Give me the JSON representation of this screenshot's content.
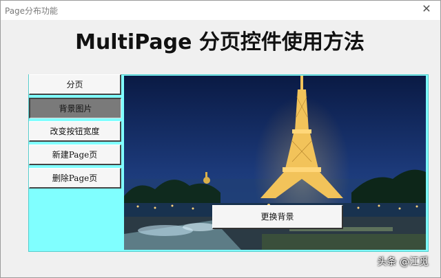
{
  "window": {
    "title": "Page分布功能",
    "close_glyph": "✕"
  },
  "heading": "MultiPage 分页控件使用方法",
  "tabs": [
    {
      "label": "分页",
      "active": false
    },
    {
      "label": "背景图片",
      "active": true
    },
    {
      "label": "改变按钮宽度",
      "active": false
    },
    {
      "label": "新建Page页",
      "active": false
    },
    {
      "label": "删除Page页",
      "active": false
    }
  ],
  "page": {
    "button_label": "更换背景",
    "background_image": "eiffel-tower-night"
  },
  "watermark": "头条 @江觅",
  "colors": {
    "frame": "#80ffff",
    "sky": "#0b1e4a",
    "tower": "#f2c35a"
  }
}
